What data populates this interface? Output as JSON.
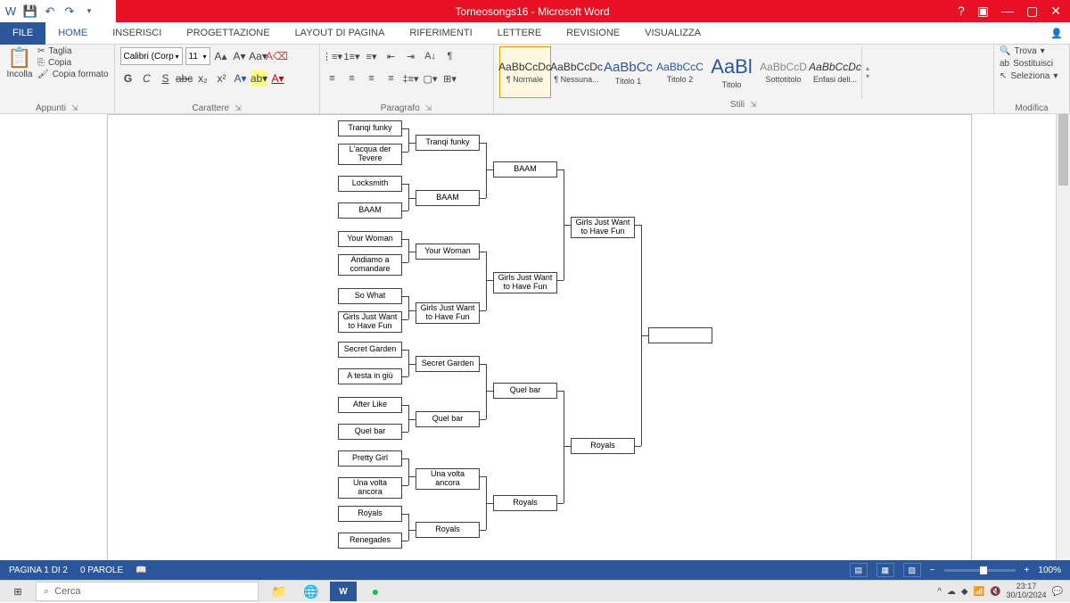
{
  "title": "Torneosongs16 - Microsoft Word",
  "qat": {
    "undo": "↶",
    "redo": "↷"
  },
  "tabs": [
    "FILE",
    "HOME",
    "INSERISCI",
    "PROGETTAZIONE",
    "LAYOUT DI PAGINA",
    "RIFERIMENTI",
    "LETTERE",
    "REVISIONE",
    "VISUALIZZA"
  ],
  "ribbon": {
    "clipboard": {
      "paste": "Incolla",
      "cut": "Taglia",
      "copy": "Copia",
      "format": "Copia formato",
      "label": "Appunti"
    },
    "font": {
      "name": "Calibri (Corp",
      "size": "11",
      "label": "Carattere",
      "bold": "G",
      "italic": "C",
      "under": "S",
      "strike": "abc",
      "sub": "x₂",
      "sup": "x²"
    },
    "para": {
      "label": "Paragrafo"
    },
    "styles": {
      "label": "Stili",
      "items": [
        {
          "prev": "AaBbCcDc",
          "name": "¶ Normale"
        },
        {
          "prev": "AaBbCcDc",
          "name": "¶ Nessuna..."
        },
        {
          "prev": "AaBbCc",
          "name": "Titolo 1"
        },
        {
          "prev": "AaBbCcC",
          "name": "Titolo 2"
        },
        {
          "prev": "AaBl",
          "name": "Titolo"
        },
        {
          "prev": "AaBbCcD",
          "name": "Sottotitolo"
        },
        {
          "prev": "AaBbCcDc",
          "name": "Enfasi deli..."
        }
      ]
    },
    "editing": {
      "find": "Trova",
      "replace": "Sostituisci",
      "select": "Seleziona",
      "label": "Modifica"
    }
  },
  "bracket": {
    "r1": [
      "Tranqi funky",
      "L'acqua der Tevere",
      "Locksmith",
      "BAAM",
      "Your Woman",
      "Andiamo a comandare",
      "So What",
      "Girls Just Want to Have Fun",
      "Secret Garden",
      "A testa in giù",
      "After Like",
      "Quel bar",
      "Pretty Girl",
      "Una volta ancora",
      "Royals",
      "Renegades"
    ],
    "r2": [
      "Tranqi funky",
      "BAAM",
      "Your Woman",
      "Girls Just Want to Have Fun",
      "Secret Garden",
      "Quel bar",
      "Una volta ancora",
      "Royals"
    ],
    "r3": [
      "BAAM",
      "Girls Just Want to Have Fun",
      "Quel bar",
      "Royals"
    ],
    "r4": [
      "Girls Just Want to Have Fun",
      "Royals"
    ],
    "r5": [
      ""
    ]
  },
  "status": {
    "page": "PAGINA 1 DI 2",
    "words": "0 PAROLE",
    "zoom": "100%"
  },
  "taskbar": {
    "search": "Cerca",
    "time": "23:17",
    "date": "30/10/2024"
  }
}
